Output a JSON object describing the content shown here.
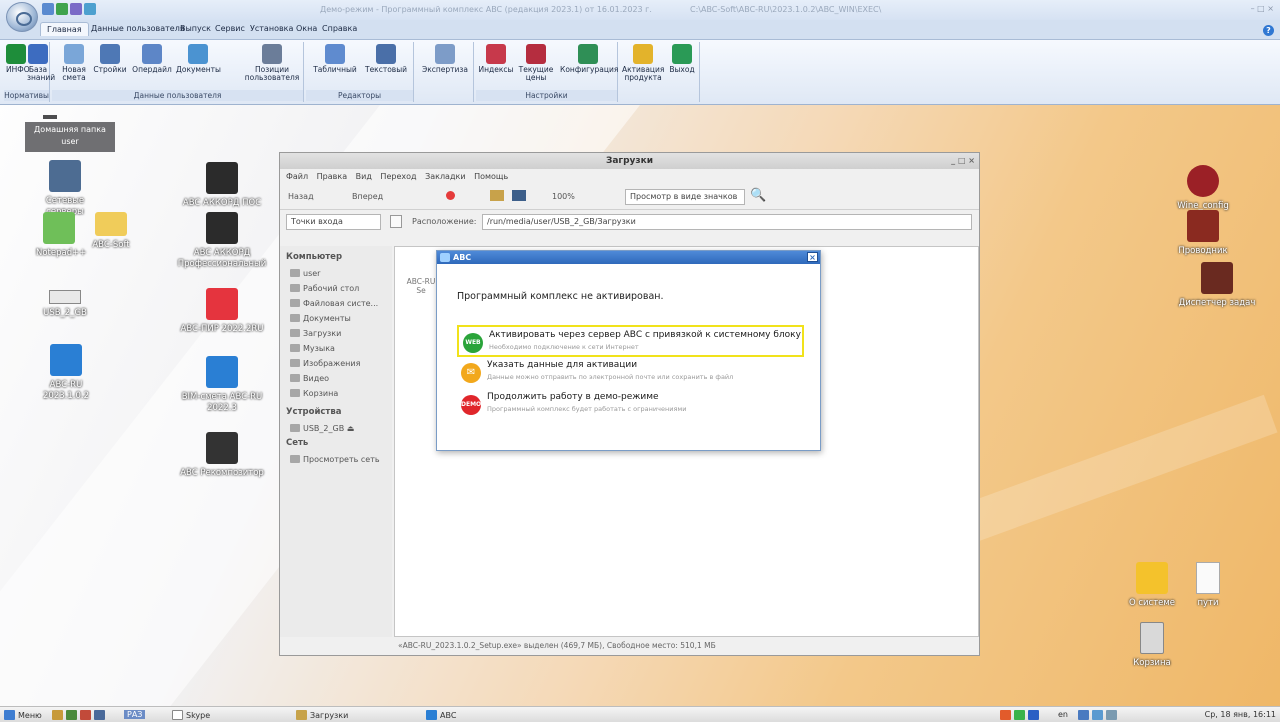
{
  "titlebar": {
    "title": "Демо-режим  -  Программный комплекс ABC (редакция 2023.1) от 16.01.2023 г.",
    "path": "C:\\ABC-Soft\\ABC-RU\\2023.1.0.2\\ABC_WIN\\EXEC\\",
    "window_controls": "– □ ×"
  },
  "ribbon": {
    "tabs": [
      "Главная",
      "Данные пользователя",
      "Выпуск",
      "Сервис",
      "Установка",
      "Окна",
      "Справка"
    ],
    "groups": {
      "normatives": {
        "label": "Нормативы",
        "buttons": [
          "ИНФО",
          "База знаний"
        ]
      },
      "userdata": {
        "label": "Данные пользователя",
        "buttons": [
          "Новая смета",
          "Стройки",
          "Опердайл",
          "Документы",
          "Позиции пользователя"
        ]
      },
      "editors": {
        "label": "Редакторы",
        "buttons": [
          "Табличный",
          "Текстовый"
        ]
      },
      "expertise": {
        "buttons": [
          "Экспертиза"
        ]
      },
      "settings": {
        "label": "Настройки",
        "buttons": [
          "Индексы",
          "Текущие цены",
          "Конфигурация"
        ]
      },
      "misc": {
        "buttons": [
          "Активация продукта",
          "Выход"
        ]
      }
    }
  },
  "desktop": {
    "home_folder": "Домашняя папка user",
    "icons_left": [
      "Сетевые серверы",
      "Notepad++",
      "ABC-Soft",
      "USB_2_GB",
      "ABC-RU 2023.1.0.2"
    ],
    "icons_mid": [
      "ABC АККОРД ПОС",
      "ABC АККОРД Профессиональный",
      "ABC-ПИР 2022.2RU",
      "BIM-смета ABC-RU 2022.3",
      "ABC Рекомпозитор"
    ],
    "icons_right": [
      "Wine_config",
      "Проводник",
      "Диспетчер задач"
    ],
    "icons_bottom": [
      "О системе",
      "пути",
      "Корзина"
    ]
  },
  "filemanager": {
    "title": "Загрузки",
    "menu": [
      "Файл",
      "Правка",
      "Вид",
      "Переход",
      "Закладки",
      "Помощь"
    ],
    "back": "Назад",
    "forward": "Вперед",
    "zoom": "100%",
    "view_mode": "Просмотр в виде значков",
    "entry_points": "Точки входа",
    "location_label": "Расположение:",
    "location_value": "/run/media/user/USB_2_GB/Загрузки",
    "sidebar": {
      "computer_header": "Компьютер",
      "computer_items": [
        "user",
        "Рабочий стол",
        "Файловая систе...",
        "Документы",
        "Загрузки",
        "Музыка",
        "Изображения",
        "Видео",
        "Корзина"
      ],
      "devices_header": "Устройства",
      "devices_items": [
        "USB_2_GB"
      ],
      "network_header": "Сеть",
      "network_items": [
        "Просмотреть сеть"
      ]
    },
    "file_label": "ABC-RU Se",
    "status": "«ABC-RU_2023.1.0.2_Setup.exe» выделен (469,7 МБ), Свободное место: 510,1 МБ"
  },
  "dialog": {
    "title": "ABC",
    "message": "Программный комплекс не активирован.",
    "options": [
      {
        "icon_text": "WEB",
        "title": "Активировать через сервер ABC с привязкой к системному блоку",
        "subtitle": "Необходимо подключение к сети Интернет",
        "color": "#2aa43a"
      },
      {
        "icon_text": "✉",
        "title": "Указать данные для активации",
        "subtitle": "Данные можно отправить по электронной почте или сохранить в файл",
        "color": "#f2a81c"
      },
      {
        "icon_text": "DEMO",
        "title": "Продолжить работу в демо-режиме",
        "subtitle": "Программный комплекс будет работать с ограничениями",
        "color": "#e0262b"
      }
    ],
    "highlight_color": "#f1e21a"
  },
  "taskbar": {
    "menu": "Меню",
    "items": [
      "РАЗ",
      "Skype",
      "Загрузки",
      "ABC"
    ],
    "lang": "en",
    "clock": "Ср, 18 янв, 16:11"
  }
}
